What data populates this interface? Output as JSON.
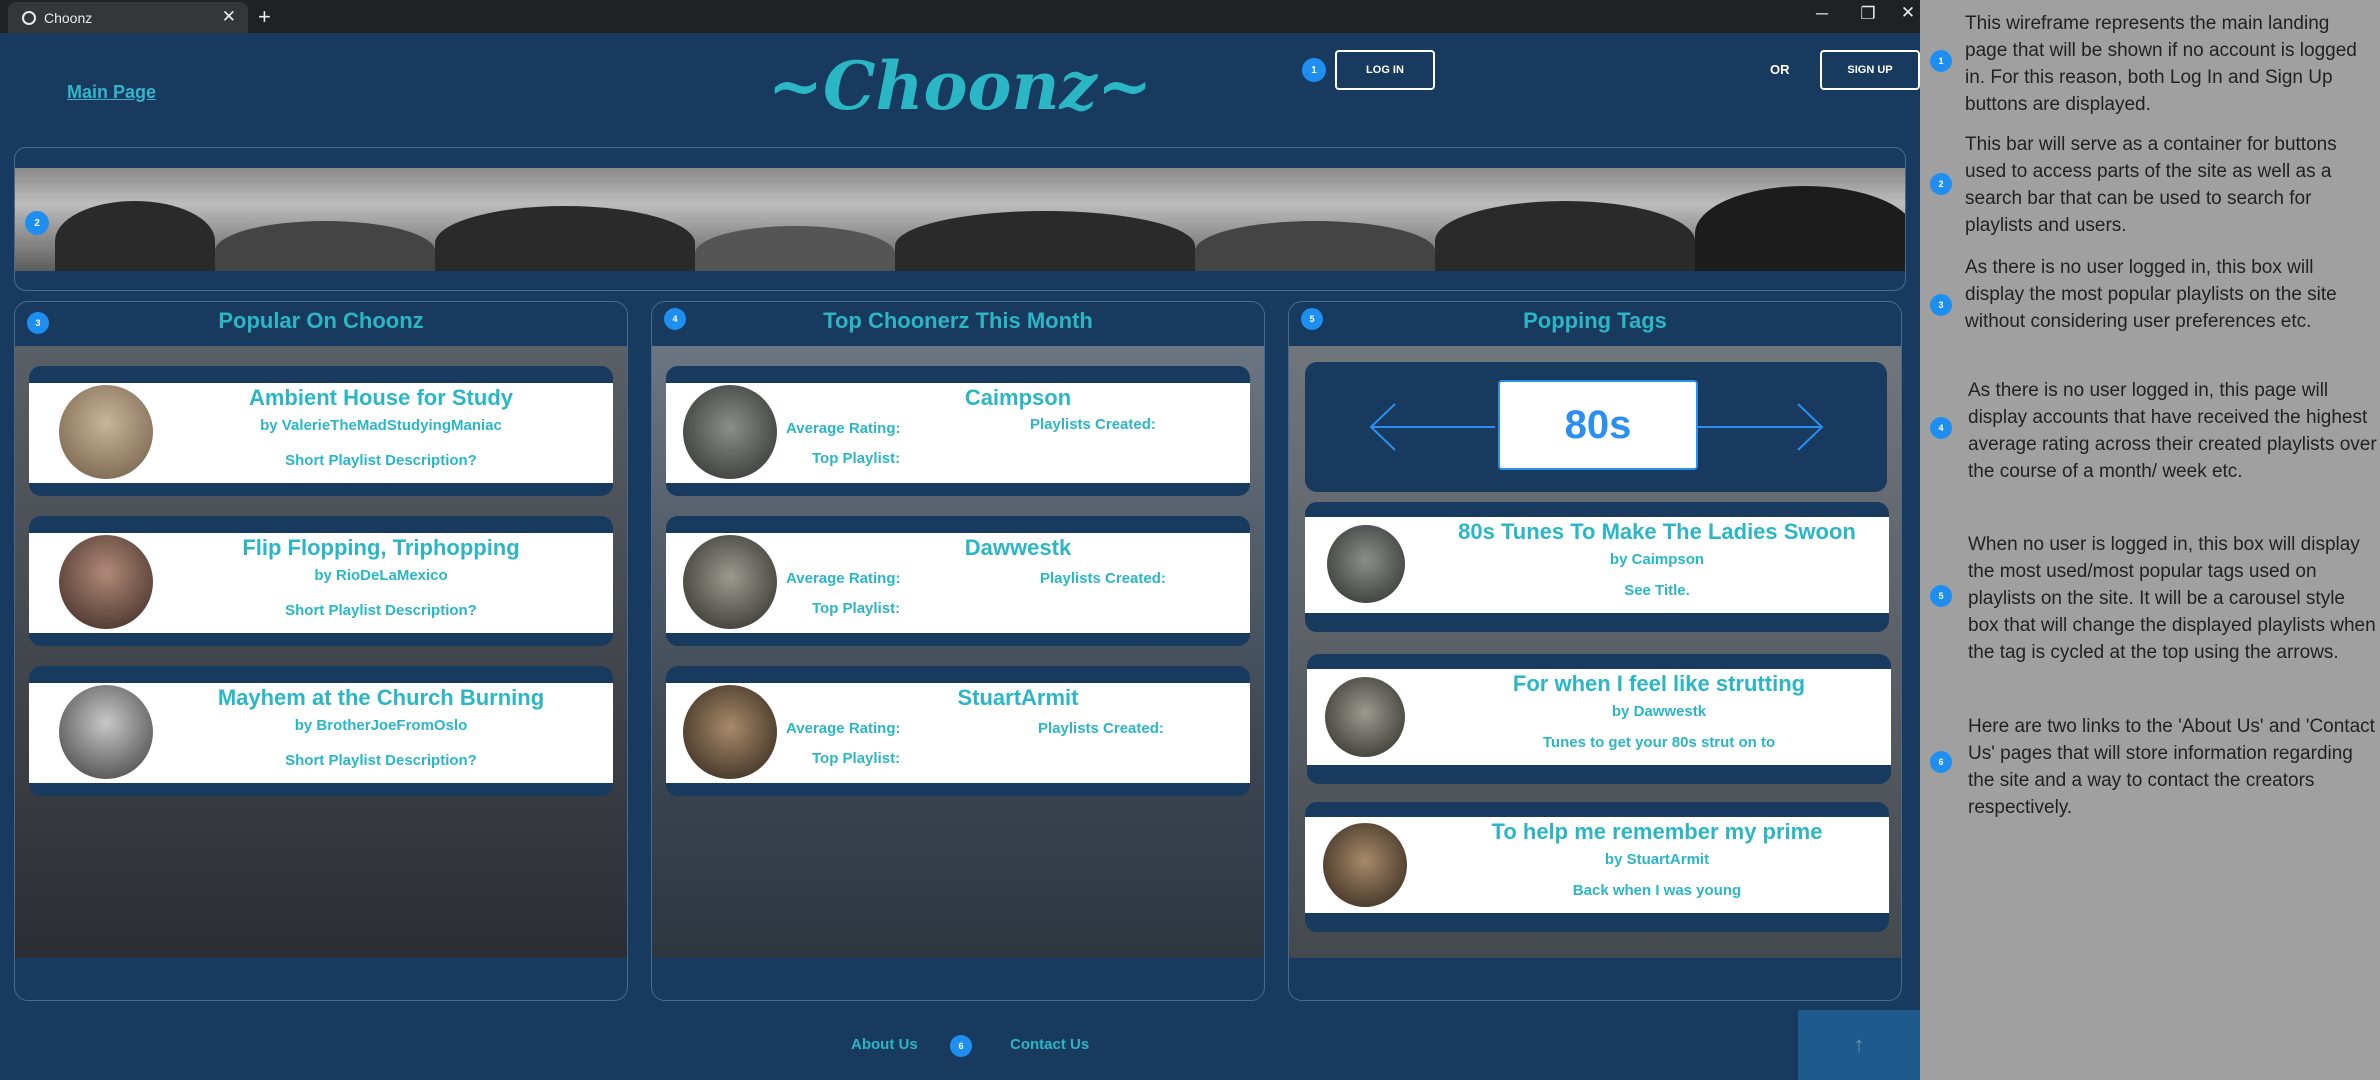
{
  "browser": {
    "tab_title": "Choonz",
    "tab_close": "✕",
    "new_tab": "+",
    "minimize": "─",
    "restore": "❐",
    "close": "✕"
  },
  "header": {
    "main_link": "Main Page",
    "logo": "~Choonz~",
    "login_label": "LOG IN",
    "or_label": "OR",
    "signup_label": "SIGN UP"
  },
  "badges": [
    "1",
    "2",
    "3",
    "4",
    "5",
    "6"
  ],
  "popular": {
    "title": "Popular On Choonz",
    "cards": [
      {
        "title": "Ambient House for Study",
        "by": "by ValerieTheMadStudyingManiac",
        "desc": "Short Playlist Description?"
      },
      {
        "title": "Flip Flopping, Triphopping",
        "by": "by RioDeLaMexico",
        "desc": "Short Playlist Description?"
      },
      {
        "title": "Mayhem at the Church Burning",
        "by": "by BrotherJoeFromOslo",
        "desc": "Short Playlist Description?"
      }
    ]
  },
  "choonerz": {
    "title": "Top Choonerz This Month",
    "labels": {
      "rating": "Average Rating:",
      "created": "Playlists Created:",
      "top": "Top Playlist:"
    },
    "cards": [
      {
        "name": "Caimpson"
      },
      {
        "name": "Dawwestk"
      },
      {
        "name": "StuartArmit"
      }
    ]
  },
  "tags": {
    "title": "Popping Tags",
    "current_tag": "80s",
    "prev_arrow": "left-arrow-icon",
    "next_arrow": "right-arrow-icon",
    "cards": [
      {
        "title": "80s Tunes To Make The Ladies Swoon",
        "by": "by Caimpson",
        "desc": "See Title."
      },
      {
        "title": "For when I feel  like strutting",
        "by": "by Dawwestk",
        "desc": "Tunes to get your 80s strut on to"
      },
      {
        "title": "To help me remember my prime",
        "by": "by StuartArmit",
        "desc": "Back when I was young"
      }
    ]
  },
  "footer": {
    "about": "About Us",
    "contact": "Contact Us",
    "top_icon": "↑"
  },
  "notes": [
    "This wireframe represents the main landing page that will be shown if no account is logged in.  For this reason, both Log In and Sign Up buttons are displayed.",
    "This bar will serve as a container for buttons used to access parts of the site as well as a search bar that can be used to search for playlists and users.",
    "As there is no user logged in, this box will display the most popular playlists on the site without considering user preferences etc.",
    "As there is no user logged in, this page will display accounts that have received the highest average rating across their created playlists over the course of a month/ week etc.",
    "When no user is logged in, this box will display the most used/most popular tags used on playlists on the site.  It will be a carousel style box that will change the displayed playlists when the tag is cycled at the top using the arrows.",
    "Here are two links to the 'About Us' and 'Contact Us' pages that will store information regarding the site and a way to contact the creators respectively."
  ],
  "colors": {
    "page_bg": "#173a5e",
    "accent": "#2bb6c6",
    "badge": "#1e8ff0",
    "sidebar": "#a0a0a0"
  }
}
